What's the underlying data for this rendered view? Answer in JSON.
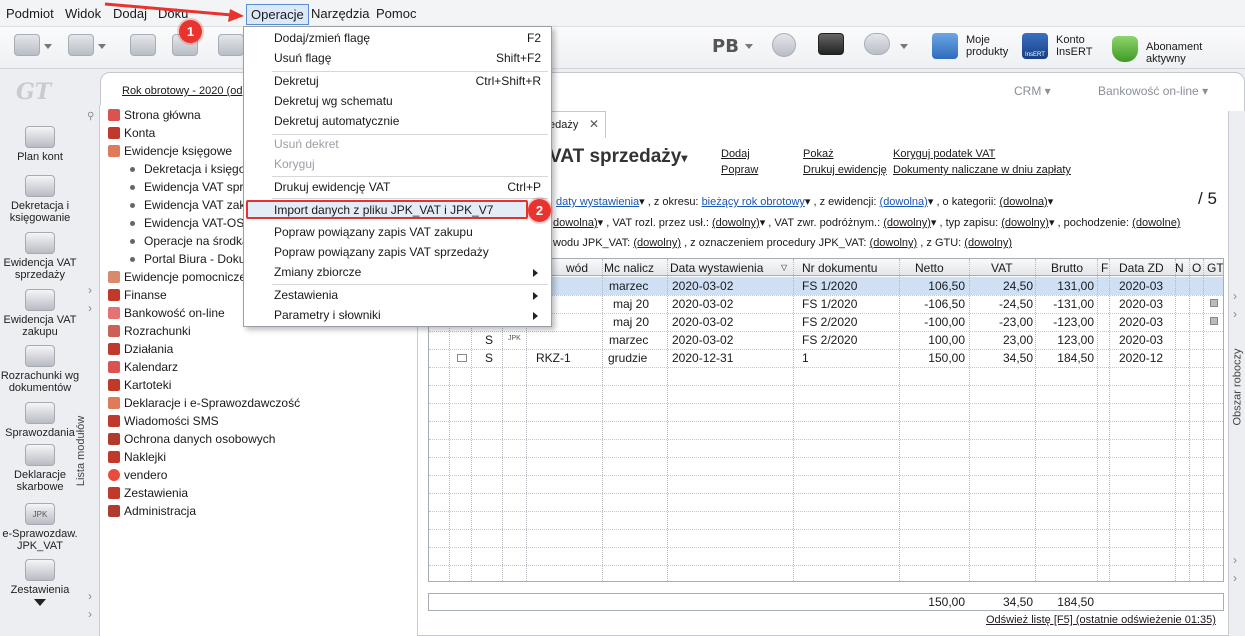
{
  "menubar": [
    "Podmiot",
    "Widok",
    "Dodaj",
    "Dokumenty",
    "Operacje",
    "Narzędzia",
    "Pomoc"
  ],
  "menubar_visible": [
    "Podmiot",
    "Widok",
    "Dodaj",
    "Doku",
    "Operacje",
    "Narzędzia",
    "Pomoc"
  ],
  "toolbar": {
    "pb": "PB",
    "moje_produkty": [
      "Moje",
      "produkty"
    ],
    "konto_insert": [
      "Konto",
      "InsERT"
    ],
    "konto_logo": "InsERT",
    "abonament": "Abonament aktywny"
  },
  "leftnav": [
    "Plan kont",
    "Dekretacja i księgowanie",
    "Ewidencja VAT sprzedaży",
    "Ewidencja VAT zakupu",
    "Rozrachunki wg dokumentów",
    "Sprawozdania",
    "Deklaracje skarbowe",
    "e-Sprawozdaw. JPK_VAT",
    "Zestawienia"
  ],
  "leftnav_lines": [
    [
      "Plan kont"
    ],
    [
      "Dekretacja i",
      "księgowanie"
    ],
    [
      "Ewidencja VAT",
      "sprzedaży"
    ],
    [
      "Ewidencja VAT",
      "zakupu"
    ],
    [
      "Rozrachunki wg",
      "dokumentów"
    ],
    [
      "Sprawozdania"
    ],
    [
      "Deklaracje",
      "skarbowe"
    ],
    [
      "e-Sprawozdaw.",
      "JPK_VAT"
    ],
    [
      "Zestawienia"
    ]
  ],
  "logo": "GT",
  "jpk_icon_label": "JPK",
  "year_bar": "Rok obrotowy - 2020  (od",
  "crm": "CRM",
  "bank": "Bankowość on-line",
  "tree": {
    "tab_label": "Lista modułów",
    "items": [
      {
        "label": "Strona główna",
        "level": 0
      },
      {
        "label": "Konta",
        "level": 0
      },
      {
        "label": "Ewidencje księgowe",
        "level": 0
      },
      {
        "label": "Dekretacja i księgo",
        "level": 1
      },
      {
        "label": "Ewidencja VAT sprz",
        "level": 1
      },
      {
        "label": "Ewidencja VAT zaku",
        "level": 1
      },
      {
        "label": "Ewidencja VAT-OSS",
        "level": 1
      },
      {
        "label": "Operacje na środka",
        "level": 1
      },
      {
        "label": "Portal Biura - Doku",
        "level": 1
      },
      {
        "label": "Ewidencje pomocnicze",
        "level": 0
      },
      {
        "label": "Finanse",
        "level": 0
      },
      {
        "label": "Bankowość on-line",
        "level": 0
      },
      {
        "label": "Rozrachunki",
        "level": 0
      },
      {
        "label": "Działania",
        "level": 0
      },
      {
        "label": "Kalendarz",
        "level": 0
      },
      {
        "label": "Kartoteki",
        "level": 0
      },
      {
        "label": "Deklaracje i e-Sprawozdawczość",
        "level": 0
      },
      {
        "label": "Wiadomości SMS",
        "level": 0
      },
      {
        "label": "Ochrona danych osobowych",
        "level": 0
      },
      {
        "label": "Naklejki",
        "level": 0
      },
      {
        "label": "vendero",
        "level": 0
      },
      {
        "label": "Zestawienia",
        "level": 0
      },
      {
        "label": "Administracja",
        "level": 0
      }
    ]
  },
  "doc_tab": "edaży",
  "heading": "VAT sprzedaży",
  "actions": [
    "Dodaj",
    "Popraw",
    "Pokaż",
    "Drukuj ewidencję",
    "Koryguj podatek VAT",
    "Dokumenty naliczane w dniu zapłaty"
  ],
  "filters": {
    "row1": [
      {
        "label": "",
        "value": "daty wystawienia"
      },
      {
        "label": ", z okresu:",
        "value": "bieżący rok obrotowy"
      },
      {
        "label": ", z ewidencji:",
        "value": "(dowolna)"
      },
      {
        "label": ", o kategorii:",
        "value": "(dowolna)"
      }
    ],
    "row2": [
      {
        "label": "",
        "value": "dowolna)"
      },
      {
        "label": ", VAT rozl. przez usł.:",
        "value": "(dowolny)"
      },
      {
        "label": ", VAT zwr. podróżnym.:",
        "value": "(dowolny)"
      },
      {
        "label": ", typ zapisu:",
        "value": "(dowolny)"
      },
      {
        "label": ", pochodzenie:",
        "value": "(dowolne)"
      }
    ],
    "row3": [
      {
        "label": "wodu JPK_VAT:",
        "value": "(dowolny)"
      },
      {
        "label": ", z oznaczeniem procedury JPK_VAT:",
        "value": "(dowolny)"
      },
      {
        "label": ", z GTU:",
        "value": "(dowolny)"
      }
    ],
    "count": "/ 5"
  },
  "grid": {
    "headers": [
      "wód",
      "Mc nalicz",
      "Data wystawienia",
      "Nr dokumentu",
      "Netto",
      "VAT",
      "Brutto",
      "F",
      "Data ZD",
      "N",
      "O",
      "GT"
    ],
    "rows": [
      {
        "type": "",
        "jpk": "",
        "powod": "",
        "mc": "marzec",
        "data": "2020-03-02",
        "nr": "FS 1/2020",
        "netto": "106,50",
        "vat": "24,50",
        "brutto": "131,00",
        "zd": "2020-03",
        "selected": true
      },
      {
        "type": "",
        "jpk": "",
        "powod": "",
        "mc": "maj 20",
        "data": "2020-03-02",
        "nr": "FS 1/2020",
        "netto": "-106,50",
        "vat": "-24,50",
        "brutto": "-131,00",
        "zd": "2020-03",
        "selected": false
      },
      {
        "type": "",
        "jpk": "",
        "powod": "",
        "mc": "maj 20",
        "data": "2020-03-02",
        "nr": "FS 2/2020",
        "netto": "-100,00",
        "vat": "-23,00",
        "brutto": "-123,00",
        "zd": "2020-03",
        "selected": false
      },
      {
        "type": "S",
        "jpk": "JPK",
        "powod": "",
        "mc": "marzec",
        "data": "2020-03-02",
        "nr": "FS 2/2020",
        "netto": "100,00",
        "vat": "23,00",
        "brutto": "123,00",
        "zd": "2020-03",
        "selected": false
      },
      {
        "type": "S",
        "jpk": "",
        "powod": "RKZ-1",
        "mc": "grudzie",
        "data": "2020-12-31",
        "nr": "1",
        "netto": "150,00",
        "vat": "34,50",
        "brutto": "184,50",
        "zd": "2020-12",
        "selected": false
      }
    ],
    "totals": {
      "netto": "150,00",
      "vat": "34,50",
      "brutto": "184,50"
    }
  },
  "refresh": "Odśwież listę [F5] (ostatnie odświeżenie 01:35)",
  "right_panel": "Obszar roboczy",
  "dropdown": [
    {
      "label": "Dodaj/zmień flagę",
      "shortcut": "F2",
      "disabled": false
    },
    {
      "label": "Usuń flagę",
      "shortcut": "Shift+F2",
      "disabled": false
    },
    {
      "sep": true
    },
    {
      "label": "Dekretuj",
      "shortcut": "Ctrl+Shift+R",
      "disabled": false
    },
    {
      "label": "Dekretuj wg schematu",
      "shortcut": "",
      "disabled": false
    },
    {
      "label": "Dekretuj automatycznie",
      "shortcut": "",
      "disabled": false
    },
    {
      "sep": true
    },
    {
      "label": "Usuń dekret",
      "shortcut": "",
      "disabled": true
    },
    {
      "label": "Koryguj",
      "shortcut": "",
      "disabled": true
    },
    {
      "sep": true
    },
    {
      "label": "Drukuj ewidencję VAT",
      "shortcut": "Ctrl+P",
      "disabled": false
    },
    {
      "sep": true
    },
    {
      "label": "Import danych z pliku JPK_VAT i JPK_V7",
      "shortcut": "",
      "disabled": false,
      "highlight": true
    },
    {
      "label": "Popraw powiązany zapis VAT zakupu",
      "shortcut": "",
      "disabled": false
    },
    {
      "label": "Popraw powiązany zapis VAT sprzedaży",
      "shortcut": "",
      "disabled": false
    },
    {
      "label": "Zmiany zbiorcze",
      "shortcut": "",
      "disabled": false,
      "submenu": true
    },
    {
      "sep": true
    },
    {
      "label": "Zestawienia",
      "shortcut": "",
      "disabled": false,
      "submenu": true
    },
    {
      "label": "Parametry i słowniki",
      "shortcut": "",
      "disabled": false,
      "submenu": true
    }
  ],
  "annotations": [
    "1",
    "2"
  ],
  "colors": {
    "accent": "#e8332e",
    "selection": "#cfe0f5",
    "link": "#1a56b5"
  }
}
